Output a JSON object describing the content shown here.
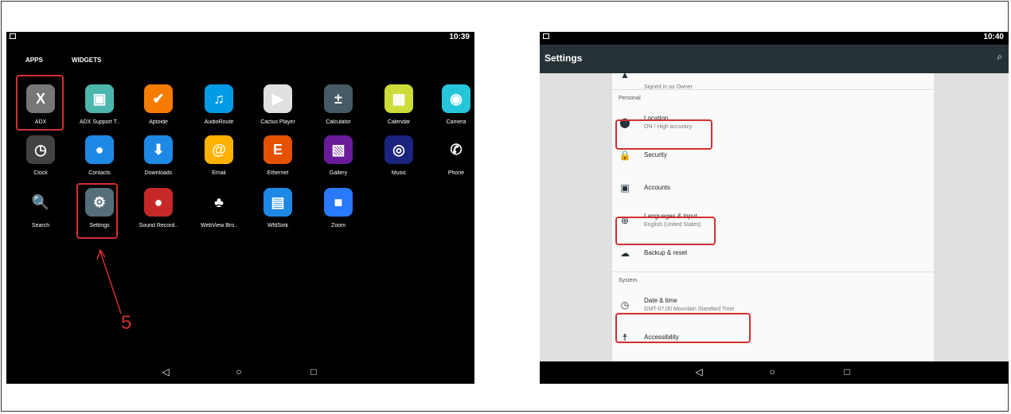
{
  "left": {
    "status_time": "10:39",
    "tabs": [
      "APPS",
      "WIDGETS"
    ],
    "apps": [
      {
        "label": "ADX",
        "color": "#777",
        "glyph": "X"
      },
      {
        "label": "ADX Support T..",
        "color": "#4db6ac",
        "glyph": "▣"
      },
      {
        "label": "Aptoide",
        "color": "#f57c00",
        "glyph": "✔"
      },
      {
        "label": "AudioRoute",
        "color": "#039be5",
        "glyph": "♫"
      },
      {
        "label": "Cactus Player",
        "color": "#e0e0e0",
        "glyph": "▶"
      },
      {
        "label": "Calculator",
        "color": "#455a64",
        "glyph": "±"
      },
      {
        "label": "Calendar",
        "color": "#cddc39",
        "glyph": "▦"
      },
      {
        "label": "Camera",
        "color": "#26c6da",
        "glyph": "◉"
      },
      {
        "label": "Clock",
        "color": "#424242",
        "glyph": "◷"
      },
      {
        "label": "Contacts",
        "color": "#1e88e5",
        "glyph": "●"
      },
      {
        "label": "Downloads",
        "color": "#1e88e5",
        "glyph": "⬇"
      },
      {
        "label": "Email",
        "color": "#ffb300",
        "glyph": "@"
      },
      {
        "label": "Ethernet",
        "color": "#e65100",
        "glyph": "E"
      },
      {
        "label": "Gallery",
        "color": "#6a1b9a",
        "glyph": "▧"
      },
      {
        "label": "Music",
        "color": "#1a237e",
        "glyph": "◎"
      },
      {
        "label": "Phone",
        "color": "#000",
        "glyph": "✆"
      },
      {
        "label": "Search",
        "color": "#000",
        "glyph": "🔍"
      },
      {
        "label": "Settings",
        "color": "#546e7a",
        "glyph": "⚙"
      },
      {
        "label": "Sound Record..",
        "color": "#c62828",
        "glyph": "●"
      },
      {
        "label": "WebView Bro..",
        "color": "#000",
        "glyph": "♣"
      },
      {
        "label": "WfdSink",
        "color": "#1e88e5",
        "glyph": "▤"
      },
      {
        "label": "Zoom",
        "color": "#2979ff",
        "glyph": "■"
      }
    ],
    "annotation": "5"
  },
  "right": {
    "status_time": "10:40",
    "title": "Settings",
    "items": [
      {
        "title": "",
        "sub": "Signed in as Owner",
        "icon": "person-icon",
        "glyph": "▲"
      },
      {
        "category": "Personal"
      },
      {
        "title": "Location",
        "sub": "ON / High accuracy",
        "icon": "location-icon",
        "glyph": "⬤"
      },
      {
        "title": "Security",
        "sub": "",
        "icon": "lock-icon",
        "glyph": "🔒"
      },
      {
        "title": "Accounts",
        "sub": "",
        "icon": "account-icon",
        "glyph": "▣"
      },
      {
        "title": "Languages & input",
        "sub": "English (United States)",
        "icon": "globe-icon",
        "glyph": "⊕"
      },
      {
        "title": "Backup & reset",
        "sub": "",
        "icon": "cloud-icon",
        "glyph": "☁"
      },
      {
        "category": "System"
      },
      {
        "title": "Date & time",
        "sub": "GMT-07:00 Mountain Standard Time",
        "icon": "clock-icon",
        "glyph": "◷"
      },
      {
        "title": "Accessibility",
        "sub": "",
        "icon": "accessibility-icon",
        "glyph": "☨"
      }
    ]
  },
  "nav": {
    "back": "◁",
    "home": "○",
    "recents": "□"
  }
}
